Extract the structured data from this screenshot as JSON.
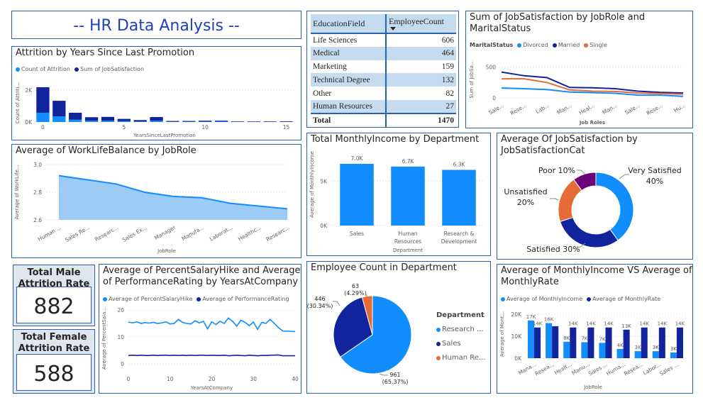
{
  "dashboard": {
    "title": "-- HR Data Analysis --"
  },
  "colors": {
    "light": "#118DFF",
    "dark": "#12239E",
    "orange": "#E66C37",
    "purple": "#6B007B",
    "area": "#9CCCF5",
    "accent": "#2a62ad"
  },
  "education_table": {
    "headers": [
      "EducationField",
      "EmployeeCount"
    ],
    "rows": [
      [
        "Life Sciences",
        "606"
      ],
      [
        "Medical",
        "464"
      ],
      [
        "Marketing",
        "159"
      ],
      [
        "Technical Degree",
        "132"
      ],
      [
        "Other",
        "82"
      ],
      [
        "Human Resources",
        "27"
      ]
    ],
    "total": [
      "Total",
      "1470"
    ]
  },
  "kpis": {
    "male": {
      "label": "Total Male Attrition Rate",
      "value": "882"
    },
    "female": {
      "label": "Total Female Attrition Rate",
      "value": "588"
    }
  },
  "chart_data": [
    {
      "id": "attrition",
      "type": "bar",
      "title": "Attrition by Years Since Last Promotion",
      "xlabel": "YearsSinceLastPromotion",
      "ylabel": "Count of Attriti...",
      "x": [
        0,
        1,
        2,
        3,
        4,
        5,
        6,
        7,
        8,
        9,
        10,
        11,
        12,
        13,
        14,
        15
      ],
      "series": [
        {
          "name": "Count of Attrition",
          "values": [
            580,
            350,
            140,
            80,
            80,
            55,
            30,
            80,
            15,
            15,
            20,
            20,
            10,
            10,
            10,
            12
          ]
        },
        {
          "name": "Sum of JobSatisfaction",
          "values": [
            1600,
            980,
            440,
            220,
            240,
            140,
            90,
            230,
            50,
            50,
            60,
            60,
            30,
            30,
            30,
            35
          ]
        }
      ],
      "stacked": true,
      "ylim": [
        0,
        2400
      ],
      "yticks": [
        0,
        2000
      ],
      "ytick_labels": [
        "0K",
        "2K"
      ],
      "xticks": [
        0,
        5,
        10,
        15
      ],
      "legend": "top-left"
    },
    {
      "id": "jobsat_marital",
      "type": "line",
      "title": "Sum of JobSatisfaction by JobRole and MaritalStatus",
      "legend_title": "MaritalStatus",
      "xlabel": "Job Roles",
      "ylabel": "Sum of JobSa...",
      "categories": [
        "Sale...",
        "Rese...",
        "Lab...",
        "Man...",
        "Heal...",
        "Man...",
        "Sale...",
        "Rese...",
        "Hu..."
      ],
      "series": [
        {
          "name": "Divorced",
          "values": [
            160,
            150,
            135,
            95,
            85,
            75,
            45,
            45,
            25
          ]
        },
        {
          "name": "Married",
          "values": [
            420,
            360,
            330,
            170,
            165,
            150,
            110,
            90,
            80
          ]
        },
        {
          "name": "Single",
          "values": [
            310,
            310,
            250,
            130,
            110,
            105,
            80,
            70,
            60
          ]
        }
      ],
      "ylim": [
        0,
        600
      ],
      "yticks": [
        0,
        500
      ],
      "legend": "top-left"
    },
    {
      "id": "wlb",
      "type": "area",
      "title": "Average of WorkLifeBalance by JobRole",
      "xlabel": "JobRole",
      "ylabel": "Average of WorkLife...",
      "categories": [
        "Human ...",
        "Sales Re...",
        "Researc...",
        "Sales Ex...",
        "Manager",
        "Manufa...",
        "Laborat...",
        "Healthc...",
        "Researc..."
      ],
      "values": [
        2.92,
        2.89,
        2.86,
        2.8,
        2.77,
        2.76,
        2.72,
        2.7,
        2.68
      ],
      "ylim": [
        2.6,
        3.0
      ],
      "yticks": [
        2.6,
        2.8,
        3.0
      ]
    },
    {
      "id": "income_dept",
      "type": "bar",
      "title": "Total MonthlyIncome by Department",
      "xlabel": "Department",
      "ylabel": "Average of MonthlyIncome",
      "categories": [
        "Sales",
        "Human Resources",
        "Research & Development"
      ],
      "values": [
        6959,
        6655,
        6281
      ],
      "data_labels": [
        "7.0K",
        "6.7K",
        "6.3K"
      ],
      "ylim": [
        0,
        8000
      ],
      "yticks": [
        0,
        5000
      ],
      "ytick_labels": [
        "0K",
        "5K"
      ]
    },
    {
      "id": "jobsat_cat",
      "type": "pie",
      "donut": true,
      "title": "Average Of JobSatisfaction by JobSatisfactionCat",
      "categories": [
        "Very Satisfied",
        "Satisfied",
        "Unsatisfied",
        "Poor"
      ],
      "values": [
        40,
        30,
        20,
        10
      ],
      "data_labels": [
        "Very Satisfied\n40%",
        "Satisfied 30%",
        "Unsatisfied\n20%",
        "Poor 10%"
      ]
    },
    {
      "id": "salary_perf",
      "type": "line",
      "title": "Average of PercentSalaryHike and Average of PerformanceRating by YearsAtCompany",
      "xlabel": "YearsAtCompany",
      "ylabel": "Average of PercentSala...",
      "x": [
        0,
        1,
        2,
        3,
        4,
        5,
        6,
        7,
        8,
        9,
        10,
        11,
        12,
        13,
        14,
        15,
        16,
        17,
        18,
        19,
        20,
        21,
        22,
        23,
        24,
        25,
        26,
        27,
        28,
        29,
        30,
        31,
        32,
        33,
        34,
        36,
        37,
        40
      ],
      "series": [
        {
          "name": "Average of PercentSalaryHike",
          "values": [
            15.5,
            15.2,
            15.6,
            15.0,
            15.3,
            15.1,
            15.4,
            15.0,
            15.2,
            15.6,
            14.8,
            15.0,
            16.5,
            15.4,
            15.0,
            14.8,
            16.0,
            15.2,
            15.8,
            13.0,
            15.6,
            14.6,
            15.8,
            15.0,
            17.0,
            15.8,
            14.0,
            16.2,
            15.4,
            14.2,
            15.5,
            12.8,
            15.4,
            15.0,
            16.5,
            13.5,
            12.2,
            12.0
          ]
        },
        {
          "name": "Average of PerformanceRating",
          "values": [
            3.1,
            3.2,
            3.1,
            3.2,
            3.1,
            3.1,
            3.2,
            3.1,
            3.2,
            3.2,
            3.1,
            3.2,
            3.1,
            3.2,
            3.1,
            3.2,
            3.1,
            3.2,
            3.2,
            3.1,
            3.2,
            3.1,
            3.1,
            3.2,
            3.0,
            3.1,
            3.2,
            3.1,
            3.0,
            3.2,
            3.1,
            3.0,
            3.1,
            3.1,
            3.2,
            3.3,
            3.0,
            3.0
          ]
        }
      ],
      "ylim": [
        0,
        20
      ],
      "yticks": [
        0,
        10,
        20
      ],
      "xlim": [
        0,
        40
      ],
      "xticks": [
        0,
        10,
        20,
        30,
        40
      ],
      "legend": "top-left"
    },
    {
      "id": "emp_dept",
      "type": "pie",
      "title": "Employee Count in Department",
      "legend_title": "Department",
      "categories": [
        "Research ...",
        "Sales",
        "Human Re..."
      ],
      "values": [
        961,
        446,
        63
      ],
      "data_labels": [
        "961\n(65.37%)",
        "446\n(30.34%)",
        "63\n(4.29%)"
      ],
      "legend": "right"
    },
    {
      "id": "income_rate",
      "type": "bar",
      "title": "Average of MonthlyIncome VS Average of MonthlyRate",
      "xlabel": "JobRole",
      "ylabel": "Average of Mont...",
      "categories": [
        "Mana...",
        "Resea...",
        "Healt...",
        "Manu...",
        "Sales ...",
        "Huma...",
        "Resea...",
        "Labor...",
        "Sales ..."
      ],
      "series": [
        {
          "name": "Average of MonthlyIncome",
          "values": [
            17200,
            16000,
            7500,
            7300,
            7000,
            4200,
            3200,
            3200,
            2600
          ],
          "labels": [
            "17K",
            "16K",
            "8K",
            "7K",
            "7K",
            "4K",
            "3K",
            "3K",
            "3K"
          ]
        },
        {
          "name": "Average of MonthlyRate",
          "values": [
            14000,
            14600,
            14000,
            14000,
            14000,
            13000,
            14000,
            14000,
            14000
          ],
          "labels": [
            "14K",
            "",
            "14K",
            "14K",
            "14K",
            "13K",
            "14K",
            "14K",
            "14K"
          ]
        }
      ],
      "ylim": [
        0,
        22000
      ],
      "yticks": [
        0,
        10000,
        20000
      ],
      "ytick_labels": [
        "0K",
        "10K",
        "20K"
      ],
      "legend": "top-left"
    }
  ]
}
